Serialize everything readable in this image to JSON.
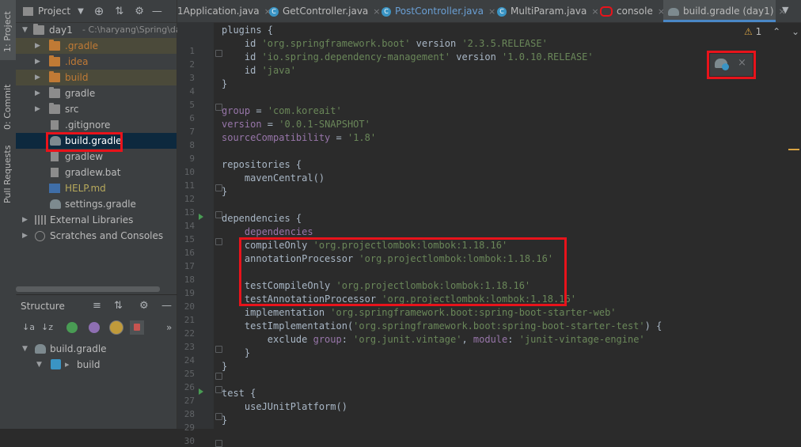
{
  "stripe": {
    "project_tab": "1: Project",
    "commit_tab": "0: Commit",
    "pull_tab": "Pull Requests"
  },
  "project_panel": {
    "title": "Project",
    "root_name": "day1",
    "root_path": "C:\\haryang\\Spring\\da",
    "items": [
      {
        "label": ".gradle"
      },
      {
        "label": ".idea"
      },
      {
        "label": "build"
      },
      {
        "label": "gradle"
      },
      {
        "label": "src"
      },
      {
        "label": ".gitignore"
      },
      {
        "label": "build.gradle"
      },
      {
        "label": "gradlew"
      },
      {
        "label": "gradlew.bat"
      },
      {
        "label": "HELP.md"
      },
      {
        "label": "settings.gradle"
      }
    ],
    "external_libraries": "External Libraries",
    "scratches": "Scratches and Consoles"
  },
  "structure_panel": {
    "title": "Structure",
    "root": "build.gradle",
    "child": "build",
    "chevron": "»"
  },
  "tabs": [
    {
      "label": "1Application.java"
    },
    {
      "label": "GetController.java"
    },
    {
      "label": "PostController.java"
    },
    {
      "label": "MultiParam.java"
    },
    {
      "label": "console"
    },
    {
      "label": "build.gradle (day1)"
    }
  ],
  "editor": {
    "warning_count": "1",
    "line_numbers": [
      "1",
      "2",
      "3",
      "4",
      "5",
      "6",
      "7",
      "8",
      "9",
      "10",
      "11",
      "12",
      "13",
      "14",
      "15",
      "16",
      "17",
      "18",
      "19",
      "20",
      "21",
      "22",
      "23",
      "24",
      "25",
      "26",
      "27",
      "28",
      "29",
      "30"
    ],
    "lines": [
      "plugins {",
      "    id 'org.springframework.boot' version '2.3.5.RELEASE'",
      "    id 'io.spring.dependency-management' version '1.0.10.RELEASE'",
      "    id 'java'",
      "}",
      "",
      "group = 'com.koreait'",
      "version = '0.0.1-SNAPSHOT'",
      "sourceCompatibility = '1.8'",
      "",
      "repositories {",
      "    mavenCentral()",
      "}",
      "",
      "dependencies {",
      "    dependencies",
      "    compileOnly 'org.projectlombok:lombok:1.18.16'",
      "    annotationProcessor 'org.projectlombok:lombok:1.18.16'",
      "",
      "    testCompileOnly 'org.projectlombok:lombok:1.18.16'",
      "    testAnnotationProcessor 'org.projectlombok:lombok:1.18.16'",
      "    implementation 'org.springframework.boot:spring-boot-starter-web'",
      "    testImplementation('org.springframework.boot:spring-boot-starter-test') {",
      "        exclude group: 'org.junit.vintage', module: 'junit-vintage-engine'",
      "    }",
      "}",
      "",
      "test {",
      "    useJUnitPlatform()",
      "}"
    ]
  },
  "colors": {
    "accent": "#4a88c7",
    "highlight_box": "#e8131b",
    "string": "#6a8759",
    "run_arrow": "#499c54"
  }
}
